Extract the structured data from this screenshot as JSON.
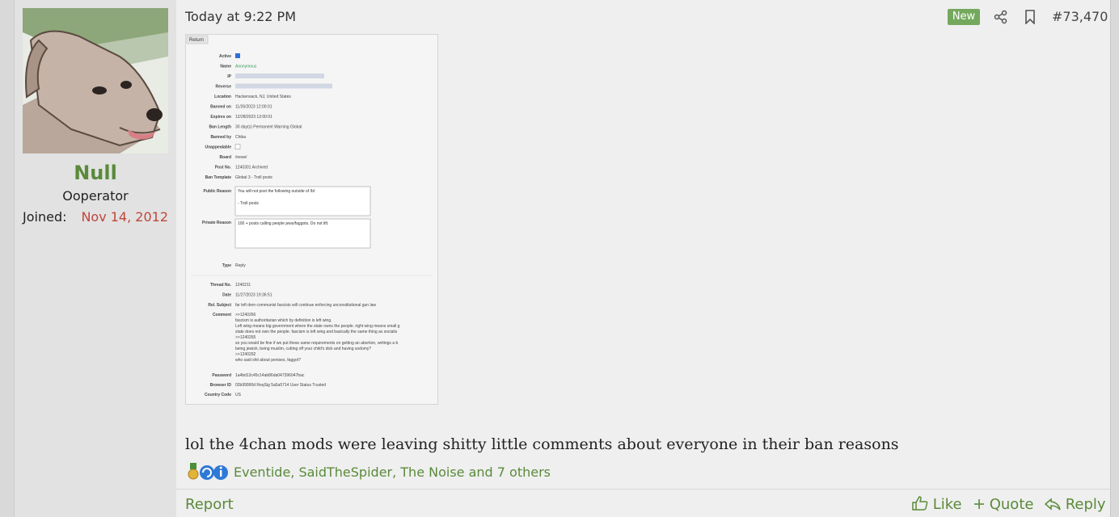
{
  "user": {
    "name": "Null",
    "title": "Ooperator",
    "joined_label": "Joined:",
    "joined_value": "Nov 14, 2012"
  },
  "post": {
    "timestamp": "Today at 9:22 PM",
    "new_badge": "New",
    "post_number": "#73,470",
    "body": "lol the 4chan mods were leaving shitty little comments about everyone in their ban reasons",
    "reactions_text": "Eventide, SaidTheSpider, The Noise and 7 others"
  },
  "attachment": {
    "return_btn": "Return",
    "rows": [
      {
        "label": "Active",
        "value": ""
      },
      {
        "label": "Name",
        "value": "Anonymous"
      },
      {
        "label": "IP",
        "value": ""
      },
      {
        "label": "Reverse",
        "value": ""
      },
      {
        "label": "Location",
        "value": "Hackensack, NJ, United States"
      },
      {
        "label": "Banned on",
        "value": "11/26/2023 12:00:01"
      },
      {
        "label": "Expires on",
        "value": "12/28/2023 12:00:01"
      },
      {
        "label": "Ban Length",
        "value": "30  day(s)  Permanent  Warning  Global"
      },
      {
        "label": "Banned by",
        "value": "Chiba"
      },
      {
        "label": "Unappealable",
        "value": ""
      },
      {
        "label": "Board",
        "value": "/news/"
      },
      {
        "label": "Post No.",
        "value": "1240301  Archived"
      },
      {
        "label": "Ban Template",
        "value": "Global 3 - Troll posts"
      }
    ],
    "public_reason_label": "Public Reason",
    "public_reason": "You will not post the following outside of /b/:\n\n- Troll posts",
    "private_reason_label": "Private Reason",
    "private_reason": "100 + posts calling people jews/faggots. Do not lift.",
    "type_label": "Type",
    "type_value": "Reply",
    "rows2": [
      {
        "label": "Thread No.",
        "value": "1240211"
      },
      {
        "label": "Date",
        "value": "11/27/2023 19:36:51"
      },
      {
        "label": "Rel. Subject",
        "value": "far left dem communist fascists will continue enforcing unconstitutional gun law"
      }
    ],
    "comment_label": "Comment",
    "comment_lines": [
      ">>1240266",
      "fascism is authoritarian which by definition is left wing.",
      "Left wing means big government where the state owns the people. right wing means small g",
      "state does not own the people. fascism is left wing and basically the same thing as socialis",
      ">>1240265",
      "so you would be fine if we put these same requirements on getting an abortion, writings a b",
      "being jewish, being muslim, cutting off your child's dick and having sodomy?",
      ">>1240292",
      "who said shit about penises, faggot?"
    ],
    "password_label": "Password",
    "password_value": "1a4bd13c45c14ab86da047396047bac",
    "browser_label": "Browser ID",
    "browser_value": "02b99990d   ReqSig 5a5a5714   User Status Trusted",
    "country_label": "Country Code",
    "country_value": "US"
  },
  "actions": {
    "report": "Report",
    "like": "Like",
    "quote": "Quote",
    "reply": "Reply"
  },
  "colors": {
    "accent": "#5a8a3a",
    "date_red": "#c0463a",
    "new_badge": "#74a95d"
  },
  "icons": [
    "share-icon",
    "bookmark-icon",
    "like-icon",
    "quote-icon",
    "reply-icon",
    "medal-icon",
    "reaction-refresh-icon",
    "reaction-info-icon"
  ]
}
